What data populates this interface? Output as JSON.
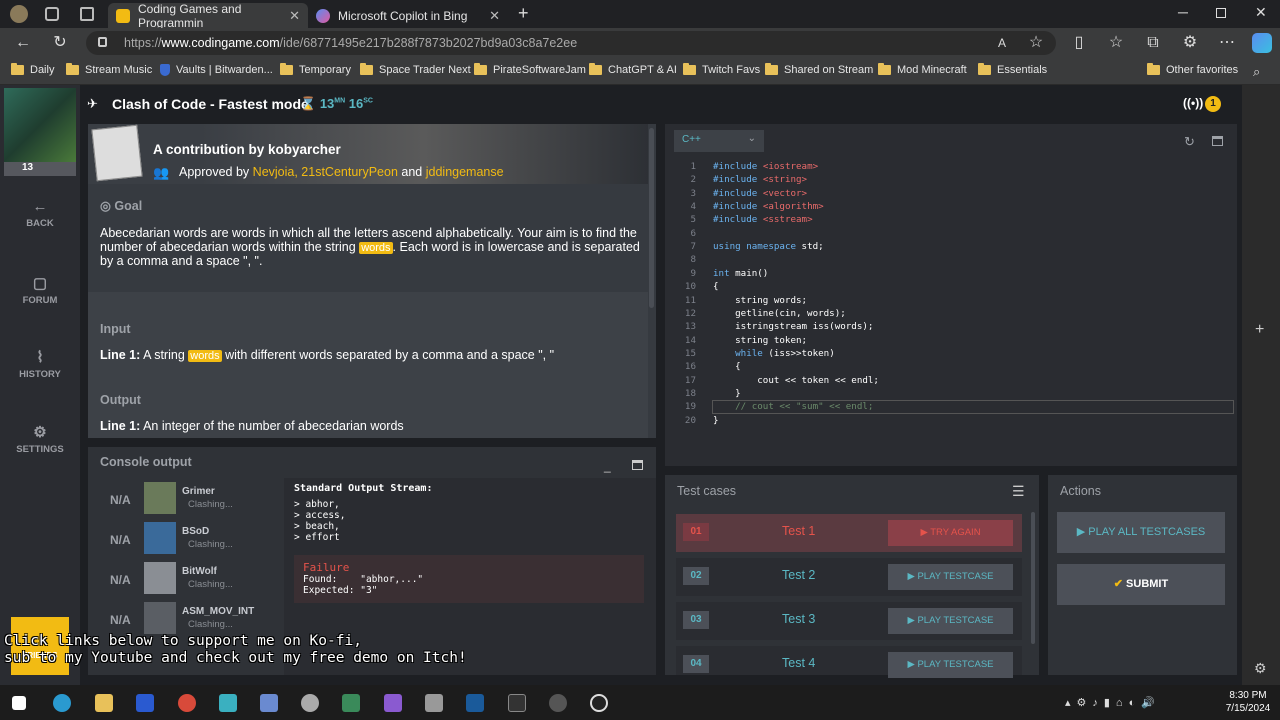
{
  "browser": {
    "tabs": [
      {
        "label": "Coding Games and Programmin",
        "active": true
      },
      {
        "label": "Microsoft Copilot in Bing",
        "active": false
      }
    ],
    "url_prefix": "https://",
    "url_domain": "www.codingame.com",
    "url_path": "/ide/68771495e217b288f7873b2027bd9a03c8a7e2ee",
    "bookmarks": [
      "Daily",
      "Stream Music",
      "Vaults | Bitwarden...",
      "Temporary",
      "Space Trader Next",
      "PirateSoftwareJam",
      "ChatGPT & AI",
      "Twitch Favs",
      "Shared on Stream",
      "Mod Minecraft",
      "Essentials",
      "Other favorites"
    ]
  },
  "nav": {
    "level": "13",
    "items": [
      {
        "label": "BACK",
        "icon": "arrow-left-icon"
      },
      {
        "label": "FORUM",
        "icon": "forum-icon"
      },
      {
        "label": "HISTORY",
        "icon": "history-icon"
      },
      {
        "label": "SETTINGS",
        "icon": "gear-icon"
      }
    ]
  },
  "header": {
    "title": "Clash of Code - Fastest mode",
    "timer_min": "13",
    "timer_min_unit": "MN",
    "timer_sec": "16",
    "timer_sec_unit": "SC",
    "broadcast_count": "1"
  },
  "statement": {
    "contribution": "A contribution by kobyarcher",
    "approved_prefix": "Approved by",
    "approvers": "Nevjoia, 21stCenturyPeon",
    "approved_and": "and",
    "approver_last": "jddingemanse",
    "goal_heading": "Goal",
    "goal_text_1": "Abecedarian words are words in which all the letters ascend alphabetically. Your aim is to find the",
    "goal_text_2a": "number of abecedarian words within the string",
    "goal_var": "words",
    "goal_text_2b": ". Each word is in lowercase and is separated",
    "goal_text_3": "by a comma and a space \", \".",
    "input_heading": "Input",
    "input_line_label": "Line 1:",
    "input_text_a": "A string",
    "input_var": "words",
    "input_text_b": "with different words separated by a comma and a space \", \"",
    "output_heading": "Output",
    "output_line_label": "Line 1:",
    "output_text": "An integer of the number of abecedarian words"
  },
  "editor": {
    "language": "C++",
    "current_line": 19,
    "lines": [
      "#include <iostream>",
      "#include <string>",
      "#include <vector>",
      "#include <algorithm>",
      "#include <sstream>",
      "",
      "using namespace std;",
      "",
      "int main()",
      "{",
      "    string words;",
      "    getline(cin, words);",
      "    istringstream iss(words);",
      "    string token;",
      "    while (iss>>token)",
      "    {",
      "        cout << token << endl;",
      "    }",
      "    // cout << \"sum\" << endl;",
      "}"
    ]
  },
  "console": {
    "title": "Console output",
    "players": [
      {
        "rank": "N/A",
        "name": "Grimer",
        "status": "Clashing..."
      },
      {
        "rank": "N/A",
        "name": "BSoD",
        "status": "Clashing..."
      },
      {
        "rank": "N/A",
        "name": "BitWolf",
        "status": "Clashing..."
      },
      {
        "rank": "N/A",
        "name": "ASM_MOV_INT",
        "status": "Clashing..."
      }
    ],
    "stream_title": "Standard Output Stream:",
    "stream_lines": [
      "> abhor,",
      "> access,",
      "> beach,",
      "> effort"
    ],
    "failure_title": "Failure",
    "found_label": "Found:",
    "found_value": "\"abhor,...\"",
    "expected_label": "Expected:",
    "expected_value": "\"3\""
  },
  "testcases": {
    "title": "Test cases",
    "items": [
      {
        "num": "01",
        "label": "Test 1",
        "button": "TRY AGAIN",
        "failed": true
      },
      {
        "num": "02",
        "label": "Test 2",
        "button": "PLAY TESTCASE",
        "failed": false
      },
      {
        "num": "03",
        "label": "Test 3",
        "button": "PLAY TESTCASE",
        "failed": false
      },
      {
        "num": "04",
        "label": "Test 4",
        "button": "PLAY TESTCASE",
        "failed": false
      }
    ]
  },
  "actions": {
    "title": "Actions",
    "play_all": "PLAY ALL TESTCASES",
    "submit": "SUBMIT"
  },
  "overlay": {
    "friends": "FRIENDS",
    "subtitle_1": "Click links below to support me on Ko-fi,",
    "subtitle_2": "sub to my Youtube and check out my free demo on Itch!"
  },
  "taskbar": {
    "time": "8:30 PM",
    "date": "7/15/2024"
  },
  "colors": {
    "accent": "#f2bb13",
    "cyan": "#5bb8c4",
    "fail": "#e5534b"
  }
}
